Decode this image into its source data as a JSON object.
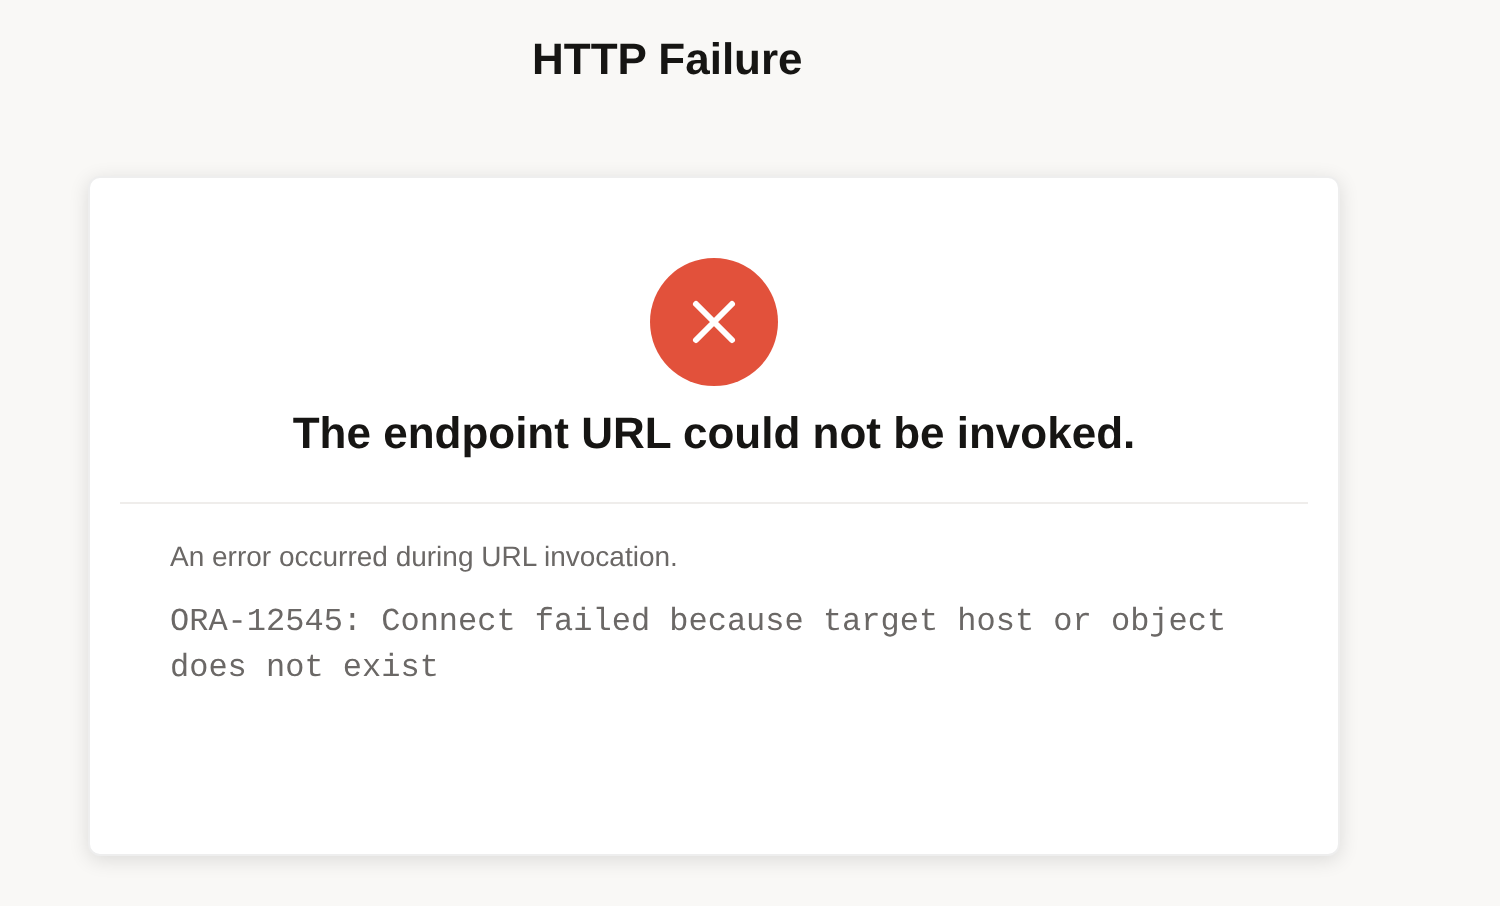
{
  "page": {
    "title": "HTTP Failure"
  },
  "dialog": {
    "kind": "error",
    "heading": "The endpoint URL could not be invoked.",
    "message": "An error occurred during URL invocation.",
    "detail": "ORA-12545: Connect failed because target host or object does not exist"
  }
}
